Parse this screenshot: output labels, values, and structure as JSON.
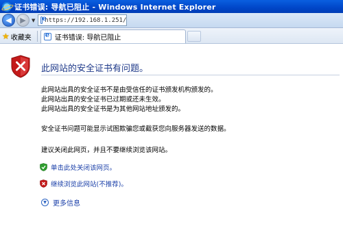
{
  "window": {
    "title": "证书错误: 导航已阻止 - Windows Internet Explorer"
  },
  "address_bar": {
    "url": "https://192.168.1.251/"
  },
  "toolbar": {
    "favorites_label": "收藏夹"
  },
  "tab": {
    "label": "证书错误: 导航已阻止"
  },
  "page": {
    "heading": "此网站的安全证书有问题。",
    "reasons": [
      "此网站出具的安全证书不是由受信任的证书颁发机构颁发的。",
      "此网站出具的安全证书已过期或还未生效。",
      "此网站出具的安全证书是为其他网站地址颁发的。"
    ],
    "warning": "安全证书问题可能显示试图欺骗您或截获您向服务器发送的数据。",
    "recommendation": "建议关闭此网页，并且不要继续浏览该网站。",
    "close_link": "单击此处关闭该网页。",
    "continue_link": "继续浏览此网站(不推荐)。",
    "more_info": "更多信息"
  },
  "colors": {
    "titlebar": "#0046c8",
    "heading": "#1f3a8a",
    "link": "#1a3fa8",
    "error_red": "#c41a1a",
    "ok_green": "#2e9e2e"
  }
}
